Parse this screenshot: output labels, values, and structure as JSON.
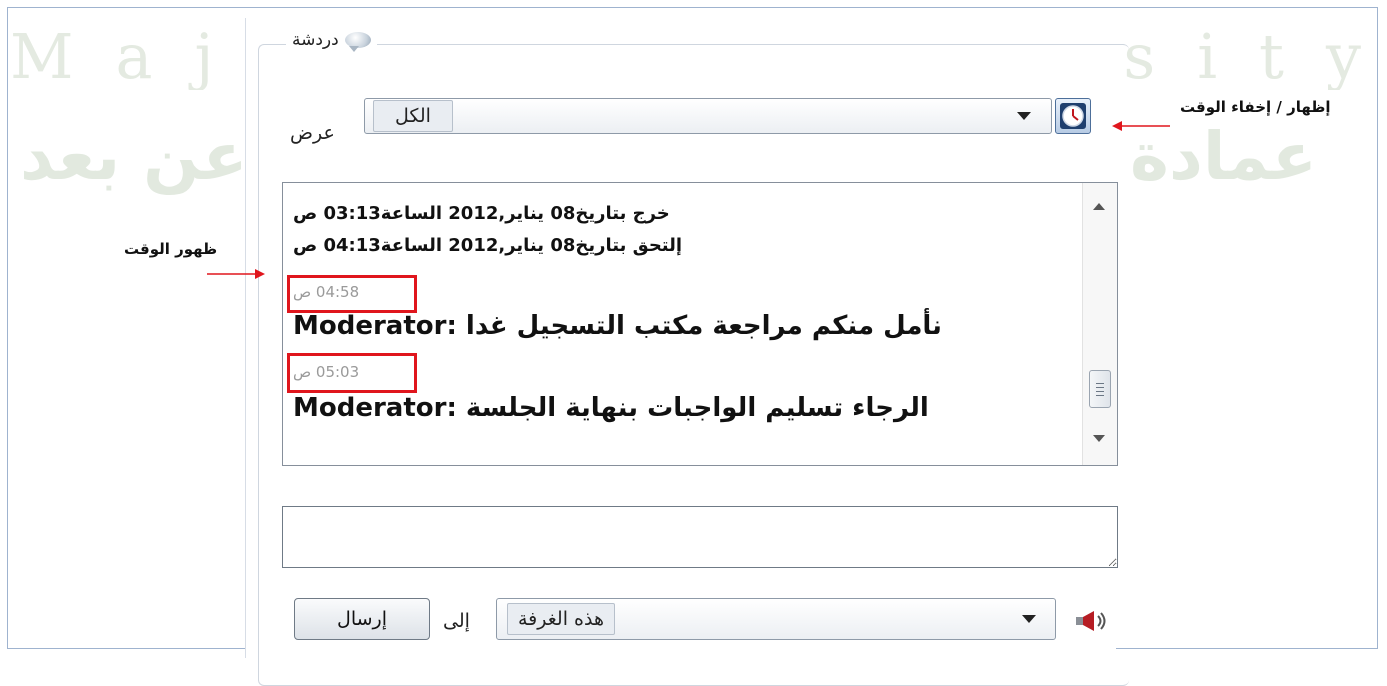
{
  "watermark": {
    "latin": "Majmaah University",
    "arabic_left": "عن بعد",
    "arabic_right": "عمادة"
  },
  "chat_panel": {
    "title": "دردشة",
    "view_label": "عرض",
    "view_filter_value": "الكل",
    "log": {
      "system_lines": [
        "خرج بتاريخ08  يناير,2012  الساعة03:13 ص",
        "إلتحق بتاريخ08  يناير,2012  الساعة04:13 ص"
      ],
      "messages": [
        {
          "time": "04:58 ص",
          "text": "نأمل منكم مراجعة مكتب التسجيل غدا :Moderator"
        },
        {
          "time": "05:03 ص",
          "text": "الرجاء تسليم الواجبات بنهاية الجلسة :Moderator"
        }
      ]
    },
    "message_input_value": "",
    "recipient_label": "إلى",
    "recipient_value": "هذه الغرفة",
    "send_label": "إرسال"
  },
  "annotations": {
    "toggle_time": "إظهار / إخفاء الوقت",
    "time_shown": "ظهور الوقت",
    "arrow_color": "#e0161d"
  },
  "icons": {
    "clock_button": "clock-icon",
    "title_bubble": "chat-bubble-icon",
    "speaker": "speaker-icon"
  }
}
